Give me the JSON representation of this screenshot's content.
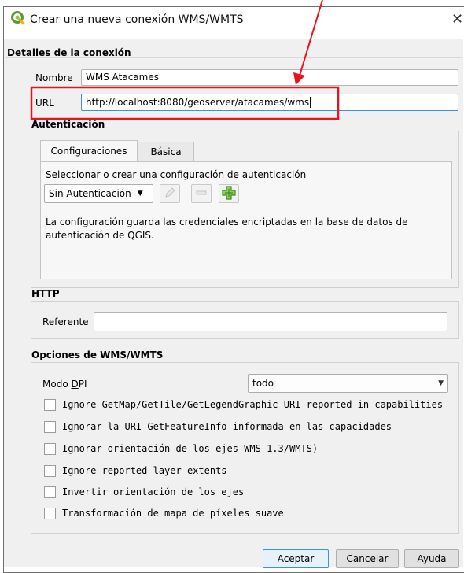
{
  "window": {
    "title": "Crear una nueva conexión WMS/WMTS",
    "close_label": "✕"
  },
  "connection": {
    "section_title": "Detalles de la conexión",
    "name_label": "Nombre",
    "name_value": "WMS Atacames",
    "url_label": "URL",
    "url_value": "http://localhost:8080/geoserver/atacames/wms"
  },
  "auth": {
    "section_title": "Autenticación",
    "tabs": [
      {
        "label": "Configuraciones",
        "active": true
      },
      {
        "label": "Básica",
        "active": false
      }
    ],
    "prompt": "Seleccionar o crear una configuración de autenticación",
    "combo_value": "Sin Autenticación",
    "note": "La configuración guarda las credenciales encriptadas en la base de datos de autenticación de QGIS."
  },
  "http": {
    "section_title": "HTTP",
    "referer_label": "Referente",
    "referer_value": ""
  },
  "wms_options": {
    "section_title": "Opciones de WMS/WMTS",
    "dpi_label_prefix": "Modo ",
    "dpi_label_underlined": "D",
    "dpi_label_suffix": "PI",
    "dpi_value": "todo",
    "checkboxes": [
      {
        "label": "Ignore GetMap/GetTile/GetLegendGraphic URI reported in capabilities",
        "checked": false
      },
      {
        "label": "Ignorar la URI GetFeatureInfo informada en las capacidades",
        "checked": false
      },
      {
        "label": "Ignorar orientación de los ejes WMS 1.3/WMTS)",
        "checked": false
      },
      {
        "label": "Ignore reported layer extents",
        "checked": false
      },
      {
        "label": "Invertir orientación de los ejes",
        "checked": false
      },
      {
        "label": "Transformación de mapa de píxeles suave",
        "checked": false
      }
    ]
  },
  "buttons": {
    "accept": "Aceptar",
    "cancel": "Cancelar",
    "help": "Ayuda"
  },
  "colors": {
    "annotation_red": "#e8141b",
    "qgis_green": "#7cb342",
    "focus_blue": "#3c93d1"
  }
}
